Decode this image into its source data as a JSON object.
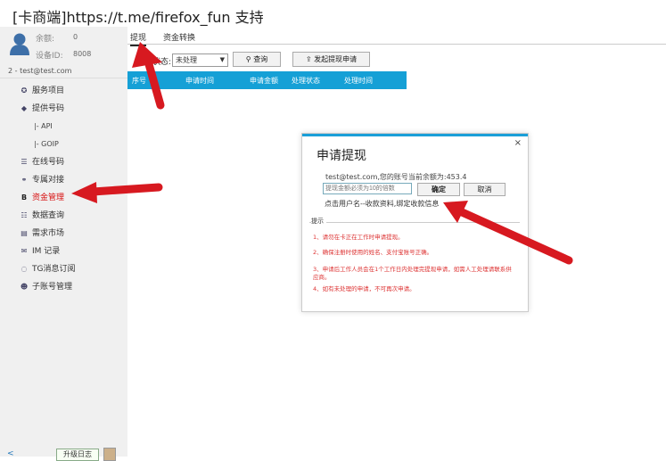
{
  "window": {
    "title": "[卡商端]https://t.me/firefox_fun 支持"
  },
  "account": {
    "balance_label": "余额:",
    "balance_value": "0",
    "device_label": "设备ID:",
    "device_value": "8008",
    "user_line": "2 - test@test.com"
  },
  "sidebar": {
    "items": [
      {
        "label": "服务项目",
        "icon": "badge-icon"
      },
      {
        "label": "提供号码",
        "icon": "caret-icon"
      },
      {
        "label": "|- API",
        "icon": ""
      },
      {
        "label": "|- GOIP",
        "icon": ""
      },
      {
        "label": "在线号码",
        "icon": "list-icon"
      },
      {
        "label": "专属对接",
        "icon": "link-icon"
      },
      {
        "label": "资金管理",
        "icon": "b-icon"
      },
      {
        "label": "数据查询",
        "icon": "list-icon"
      },
      {
        "label": "需求市场",
        "icon": "doc-icon"
      },
      {
        "label": "IM 记录",
        "icon": "mail-icon"
      },
      {
        "label": "TG消息订阅",
        "icon": "bell-icon"
      },
      {
        "label": "子账号管理",
        "icon": "users-icon"
      }
    ],
    "collapse_glyph": "<",
    "upgrade_label": "升级日志"
  },
  "tabs": [
    {
      "label": "提现"
    },
    {
      "label": "资金转换"
    }
  ],
  "toolbar": {
    "status_label": "处理状态:",
    "status_select": "未处理",
    "query_label": "查询",
    "withdraw_label": "发起提现申请"
  },
  "table": {
    "columns": [
      "序号",
      "申请时间",
      "申请金额",
      "处理状态",
      "处理时间"
    ]
  },
  "dialog": {
    "title": "申请提现",
    "close_glyph": "×",
    "account_info": "test@test.com,您的账号当前余额为:453.4",
    "amount_placeholder": "提现金额必须为10的倍数",
    "confirm_label": "确定",
    "cancel_label": "取消",
    "link_text": "点击用户名--收款资料,绑定收款信息",
    "tips_title": "提示",
    "tips": [
      "1、请勿在卡正在工作时申请提现。",
      "2、确保注册时使用的姓名、支付宝账号正确。",
      "3、申请后工作人员会在1个工作日内处理完提现申请，如需人工处理请联系供应商。",
      "4、如有未处理的申请，不可再次申请。"
    ]
  },
  "colors": {
    "accent": "#1a9fd8",
    "table_header": "#15a0d6",
    "arrow": "#d71920",
    "active_nav": "#d70f0f"
  }
}
